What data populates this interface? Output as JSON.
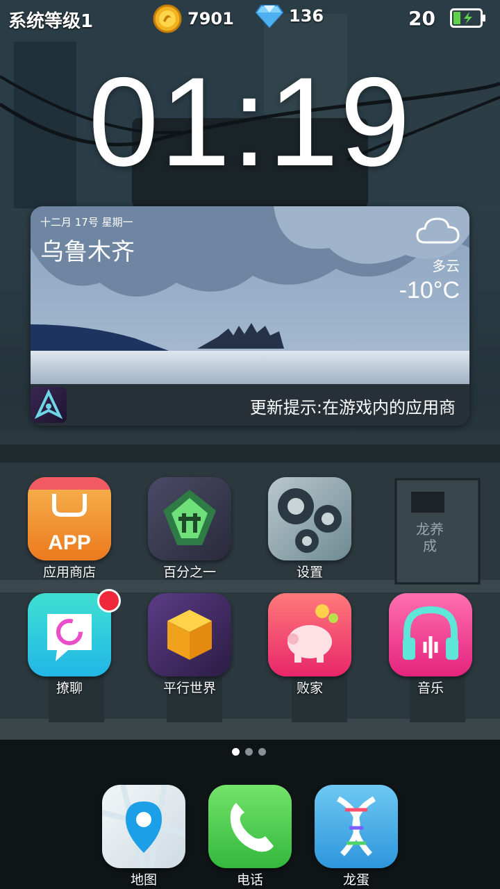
{
  "status_bar": {
    "level_text": "系统等级1",
    "coins": "7901",
    "gems": "136",
    "battery_level": "20",
    "coin_icon": "gold-coin-icon",
    "gem_icon": "diamond-icon",
    "battery_icon": "battery-charging-icon"
  },
  "clock": {
    "time": "01:19"
  },
  "weather": {
    "date": "十二月 17号 星期一",
    "city": "乌鲁木齐",
    "condition": "多云",
    "temperature": "-10°C",
    "update_tip": "更新提示:在游戏内的应用商"
  },
  "apps": [
    {
      "label": "应用商店",
      "icon": "app-store-icon",
      "tile_text": "APP"
    },
    {
      "label": "百分之一",
      "icon": "percent-game-icon"
    },
    {
      "label": "设置",
      "icon": "settings-gears-icon"
    },
    {
      "label": "撩聊",
      "icon": "chat-bubble-icon",
      "badge": true
    },
    {
      "label": "平行世界",
      "icon": "cube-icon"
    },
    {
      "label": "败家",
      "icon": "piggy-bank-icon"
    },
    {
      "label": "音乐",
      "icon": "headphones-icon"
    }
  ],
  "dock": [
    {
      "label": "地图",
      "icon": "map-pin-icon"
    },
    {
      "label": "电话",
      "icon": "phone-icon"
    },
    {
      "label": "龙蛋",
      "icon": "dna-icon"
    }
  ],
  "page_indicator": {
    "pages": 3,
    "current": 1
  },
  "wall_text": "龙养成"
}
